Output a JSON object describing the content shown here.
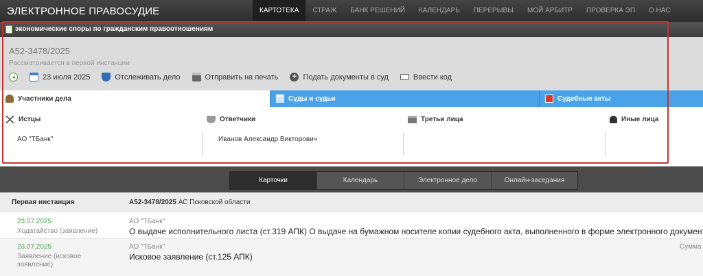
{
  "header": {
    "brand": "ЭЛЕКТРОННОЕ ПРАВОСУДИЕ",
    "nav": [
      {
        "label": "КАРТОТЕКА",
        "active": true
      },
      {
        "label": "СТРАЖ"
      },
      {
        "label": "БАНК РЕШЕНИЙ"
      },
      {
        "label": "КАЛЕНДАРЬ"
      },
      {
        "label": "ПЕРЕРЫВЫ"
      },
      {
        "label": "МОЙ АРБИТР"
      },
      {
        "label": "ПРОВЕРКА ЭП"
      },
      {
        "label": "О НАС"
      }
    ]
  },
  "case": {
    "category": "экономические споры по гражданским правоотношениям",
    "number": "А52-3478/2025",
    "status": "Рассматривается в первой инстанции",
    "toolbar": {
      "date": "23 июля 2025",
      "track": "Отслеживать дело",
      "print": "Отправить на печать",
      "submit": "Подать документы в суд",
      "code": "Ввести код"
    }
  },
  "tabs": [
    {
      "label": "Участники дела",
      "active": true
    },
    {
      "label": "Суды и судьи"
    },
    {
      "label": "Судебные акты"
    }
  ],
  "parties": {
    "plaintiffs": {
      "label": "Истцы",
      "value": "АО \"ТБанк\""
    },
    "defendants": {
      "label": "Ответчики",
      "value": "Иванов Александр Викторович"
    },
    "third": {
      "label": "Третьи лица",
      "value": ""
    },
    "other": {
      "label": "Иные лица",
      "value": ""
    }
  },
  "subtabs": [
    {
      "label": "Карточки",
      "active": true
    },
    {
      "label": "Календарь"
    },
    {
      "label": "Электронное дело"
    },
    {
      "label": "Онлайн-заседания"
    }
  ],
  "instance": {
    "label": "Первая инстанция",
    "case_number": "А52-3478/2025",
    "court": "АС Псковской области"
  },
  "events": [
    {
      "date": "23.07.2025",
      "type": "Ходатайство (заявление)",
      "who": "АО \"ТБанк\"",
      "title": "О выдаче исполнительного листа (ст.319 АПК) О выдаче на бумажном носителе копии судебного акта, выполненного в форме электронного документа",
      "sum": ""
    },
    {
      "date": "23.07.2025",
      "type": "Заявление (исковое заявление)",
      "who": "АО \"ТБанк\"",
      "title": "Исковое заявление (ст.125 АПК)",
      "sum": "Сумма и"
    }
  ],
  "colors": {
    "accent_blue": "#4aa3e8",
    "frame_red": "#c6332e",
    "date_green": "#4fa34f"
  }
}
